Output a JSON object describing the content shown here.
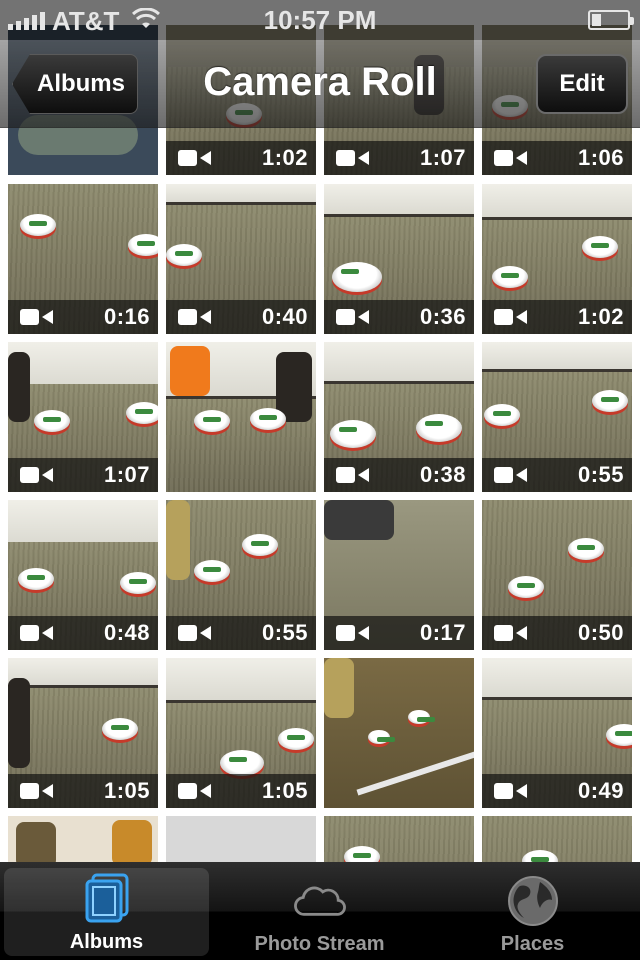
{
  "status_bar": {
    "carrier": "AT&T",
    "time": "10:57 PM"
  },
  "nav_bar": {
    "title": "Camera Roll",
    "back_label": "Albums",
    "edit_label": "Edit"
  },
  "grid": {
    "durations": [
      "1:02",
      "1:07",
      "1:06",
      "0:16",
      "0:40",
      "0:36",
      "1:02",
      "1:07",
      "",
      "0:38",
      "0:55",
      "0:48",
      "0:55",
      "0:17",
      "0:50",
      "1:05",
      "1:05",
      "",
      "0:49"
    ]
  },
  "tab_bar": {
    "tabs": [
      {
        "label": "Albums",
        "icon": "albums-icon",
        "active": true
      },
      {
        "label": "Photo Stream",
        "icon": "cloud-icon",
        "active": false
      },
      {
        "label": "Places",
        "icon": "globe-icon",
        "active": false
      }
    ]
  },
  "colors": {
    "accent": "#3aa3f0"
  }
}
